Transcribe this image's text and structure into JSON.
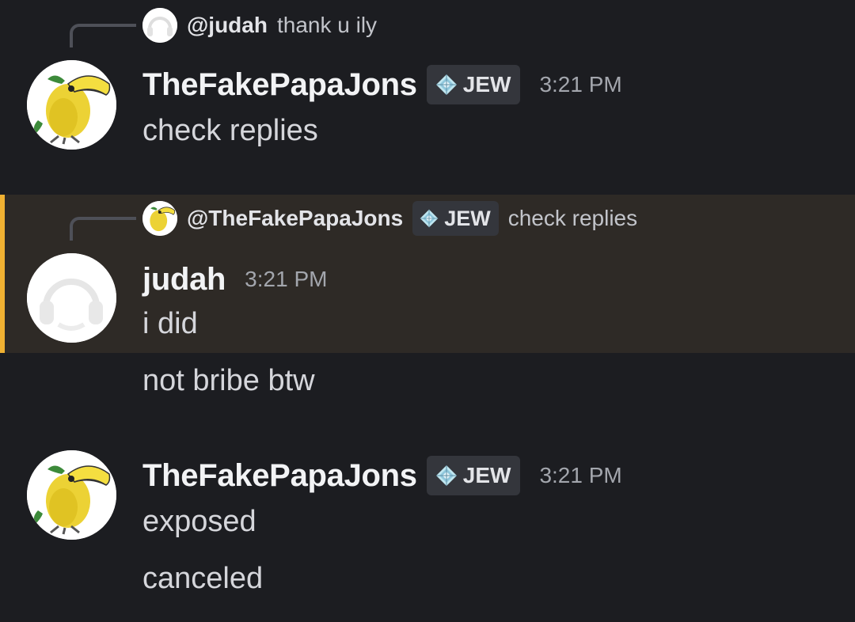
{
  "messages": [
    {
      "reply": {
        "username": "@judah",
        "text": "thank u ily"
      },
      "author": "TheFakePapaJons",
      "tag": "JEW",
      "time": "3:21 PM",
      "lines": [
        "check replies"
      ]
    },
    {
      "reply": {
        "username": "@TheFakePapaJons",
        "tag": "JEW",
        "text": "check replies"
      },
      "author": "judah",
      "time": "3:21 PM",
      "lines": [
        "i did",
        "not bribe btw"
      ]
    },
    {
      "author": "TheFakePapaJons",
      "tag": "JEW",
      "time": "3:21 PM",
      "lines": [
        "exposed",
        "canceled"
      ]
    }
  ],
  "colors": {
    "background": "#1c1d21",
    "highlight": "#2e2a26",
    "highlight_bar": "#f0b132",
    "tag_background": "#34363c"
  },
  "icons": {
    "toucan_avatar": "toucan-avatar-icon",
    "headphones_avatar": "headphones-avatar-icon",
    "tag_gem": "diamond-gem-icon"
  }
}
